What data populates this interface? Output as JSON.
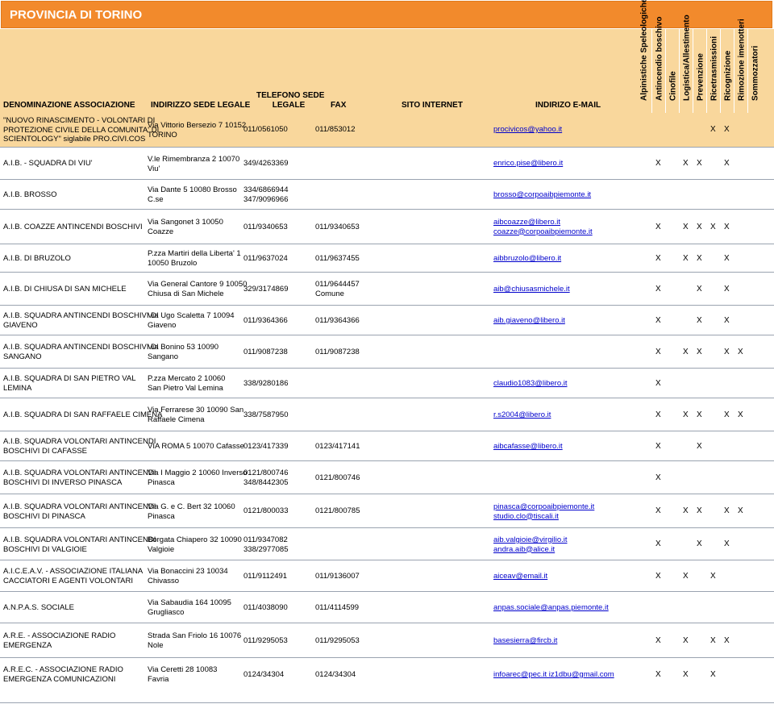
{
  "title": "PROVINCIA DI TORINO",
  "headers": {
    "denominazione": "DENOMINAZIONE ASSOCIAZIONE",
    "indirizzo": "INDIRIZZO SEDE LEGALE",
    "telefono_line1": "TELEFONO SEDE",
    "telefono_line2": "LEGALE",
    "fax": "FAX",
    "sito": "SITO INTERNET",
    "email": "INDIRIZO E-MAIL",
    "skills": [
      "Alpinistiche Speleologiche",
      "Antincendio boschivo",
      "Cinofile",
      "Logistica/Allestimento",
      "Prevenzione",
      "Ricetrasmissioni",
      "Ricognizione",
      "Rimozione imenotteri",
      "Sommozzatori"
    ]
  },
  "rows": [
    {
      "name": [
        "\"NUOVO RINASCIMENTO - VOLONTARI DI",
        "PROTEZIONE CIVILE DELLA COMUNITA' DI",
        "SCIENTOLOGY\" siglabile PRO.CIVI.COS"
      ],
      "address": [
        "Via Vittorio Bersezio  7  10152",
        "TORINO"
      ],
      "phone": [
        "011/0561050"
      ],
      "fax": [
        "011/853012"
      ],
      "email": [
        "procivicos@yahoo.it"
      ],
      "marks": [
        5,
        6
      ]
    },
    {
      "name": [
        "A.I.B. - SQUADRA DI VIU'"
      ],
      "address": [
        "V.le Rimembranza  2  10070",
        "Viu'"
      ],
      "phone": [
        "349/4263369"
      ],
      "fax": [],
      "email": [
        "enrico.pise@libero.it"
      ],
      "marks": [
        1,
        3,
        4,
        6
      ]
    },
    {
      "name": [
        "A.I.B. BROSSO"
      ],
      "address": [
        "Via Dante  5  10080 Brosso",
        "C.se"
      ],
      "phone": [
        "334/6866944",
        "347/9096966"
      ],
      "fax": [],
      "email": [
        "brosso@corpoaibpiemonte.it"
      ],
      "marks": []
    },
    {
      "name": [
        "A.I.B. COAZZE ANTINCENDI BOSCHIVI"
      ],
      "address": [
        "Via Sangonet  3  10050",
        "Coazze"
      ],
      "phone": [
        "011/9340653"
      ],
      "fax": [
        "011/9340653"
      ],
      "email": [
        "aibcoazze@libero.it",
        "coazze@corpoaibpiemonte.it"
      ],
      "marks": [
        1,
        3,
        4,
        5,
        6
      ]
    },
    {
      "name": [
        "A.I.B. DI BRUZOLO"
      ],
      "address": [
        "P.zza Martiri della Liberta'  1",
        "10050  Bruzolo"
      ],
      "phone": [
        "011/9637024"
      ],
      "fax": [
        "011/9637455"
      ],
      "email": [
        "aibbruzolo@libero.it"
      ],
      "marks": [
        1,
        3,
        4,
        6
      ]
    },
    {
      "name": [
        "A.I.B. DI CHIUSA DI SAN MICHELE"
      ],
      "address": [
        "Via General Cantore  9  10050",
        "Chiusa di San Michele"
      ],
      "phone": [
        "329/3174869"
      ],
      "fax": [
        "011/9644457",
        "Comune"
      ],
      "email": [
        "aib@chiusasmichele.it"
      ],
      "marks": [
        1,
        4,
        6
      ]
    },
    {
      "name": [
        "A.I.B. SQUADRA ANTINCENDI BOSCHIVI DI",
        "GIAVENO"
      ],
      "address": [
        "Via Ugo Scaletta  7  10094",
        "Giaveno"
      ],
      "phone": [
        "011/9364366"
      ],
      "fax": [
        "011/9364366"
      ],
      "email": [
        "aib.giaveno@libero.it"
      ],
      "marks": [
        1,
        4,
        6
      ]
    },
    {
      "name": [
        "A.I.B. SQUADRA ANTINCENDI BOSCHIVI DI",
        "SANGANO"
      ],
      "address": [
        "Via Bonino  53  10090",
        "Sangano"
      ],
      "phone": [
        "011/9087238"
      ],
      "fax": [
        "011/9087238"
      ],
      "email": [],
      "marks": [
        1,
        3,
        4,
        6,
        7
      ]
    },
    {
      "name": [
        "A.I.B. SQUADRA DI SAN PIETRO VAL",
        "LEMINA"
      ],
      "address": [
        "P.zza Mercato  2  10060",
        "San Pietro Val Lemina"
      ],
      "phone": [
        "338/9280186"
      ],
      "fax": [],
      "email": [
        "claudio1083@libero.it"
      ],
      "marks": [
        1
      ]
    },
    {
      "name": [
        "A.I.B. SQUADRA DI SAN RAFFAELE CIMENA"
      ],
      "address": [
        "Via Ferrarese  30  10090 San",
        "Raffaele Cimena"
      ],
      "phone": [
        "338/7587950"
      ],
      "fax": [],
      "email": [
        "r.s2004@libero.it"
      ],
      "marks": [
        1,
        3,
        4,
        6,
        7
      ]
    },
    {
      "name": [
        "A.I.B. SQUADRA VOLONTARI ANTINCENDI",
        "BOSCHIVI DI CAFASSE"
      ],
      "address": [
        "VIA ROMA  5  10070  Cafasse"
      ],
      "phone": [
        "0123/417339"
      ],
      "fax": [
        "0123/417141"
      ],
      "email": [
        "aibcafasse@libero.it"
      ],
      "marks": [
        1,
        4
      ]
    },
    {
      "name": [
        "A.I.B. SQUADRA VOLONTARI ANTINCENDI",
        "BOSCHIVI DI INVERSO PINASCA"
      ],
      "address": [
        "Via I Maggio  2  10060  Inverso",
        "Pinasca"
      ],
      "phone": [
        "0121/800746",
        "348/8442305"
      ],
      "fax": [
        "0121/800746"
      ],
      "email": [],
      "marks": [
        1
      ]
    },
    {
      "name": [
        "A.I.B. SQUADRA VOLONTARI ANTINCENDI",
        "BOSCHIVI DI PINASCA"
      ],
      "address": [
        "Via G. e C. Bert  32  10060",
        "Pinasca"
      ],
      "phone": [
        "0121/800033"
      ],
      "fax": [
        "0121/800785"
      ],
      "email": [
        "pinasca@corpoaibpiemonte.it",
        "studio.clo@tiscali.it"
      ],
      "marks": [
        1,
        3,
        4,
        6,
        7
      ]
    },
    {
      "name": [
        "A.I.B. SQUADRA VOLONTARI ANTINCENDI",
        "BOSCHIVI DI VALGIOIE"
      ],
      "address": [
        "Borgata Chiapero  32  10090",
        "Valgioie"
      ],
      "phone": [
        "011/9347082",
        "338/2977085"
      ],
      "fax": [],
      "email": [
        "aib.valgioie@virgilio.it",
        "andra.aib@alice.it"
      ],
      "marks": [
        1,
        4,
        6
      ]
    },
    {
      "name": [
        "A.I.C.E.A.V. - ASSOCIAZIONE ITALIANA",
        "CACCIATORI E AGENTI VOLONTARI"
      ],
      "address": [
        "Via Bonaccini  23  10034",
        "Chivasso"
      ],
      "phone": [
        "011/9112491"
      ],
      "fax": [
        "011/9136007"
      ],
      "email": [
        "aiceav@email.it"
      ],
      "marks": [
        1,
        3,
        5
      ]
    },
    {
      "name": [
        "A.N.P.A.S. SOCIALE"
      ],
      "address": [
        "Via Sabaudia  164  10095",
        "Grugliasco"
      ],
      "phone": [
        "011/4038090"
      ],
      "fax": [
        "011/4114599"
      ],
      "email": [
        "anpas.sociale@anpas.piemonte.it"
      ],
      "marks": []
    },
    {
      "name": [
        "A.R.E. - ASSOCIAZIONE RADIO",
        "EMERGENZA"
      ],
      "address": [
        "Strada San Friolo  16  10076",
        "Nole"
      ],
      "phone": [
        "011/9295053"
      ],
      "fax": [
        "011/9295053"
      ],
      "email": [
        "basesierra@fircb.it"
      ],
      "marks": [
        1,
        3,
        5,
        6
      ]
    },
    {
      "name": [
        "A.R.E.C. - ASSOCIAZIONE RADIO",
        "EMERGENZA COMUNICAZIONI"
      ],
      "address": [
        "Via Ceretti  28  10083",
        "Favria"
      ],
      "phone": [
        "0124/34304"
      ],
      "fax": [
        "0124/34304"
      ],
      "email": [
        "infoarec@pec.it  iz1dbu@gmail.com"
      ],
      "marks": [
        1,
        3,
        5
      ]
    }
  ]
}
